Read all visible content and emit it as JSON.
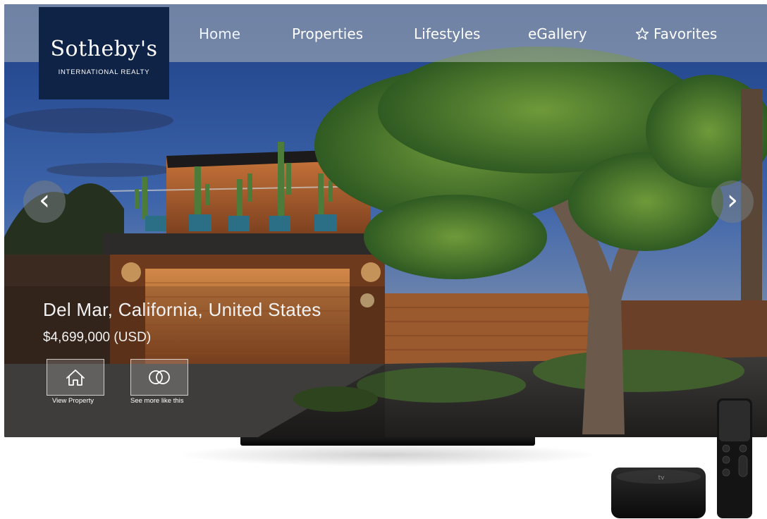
{
  "brand": {
    "name": "Sotheby's",
    "subtitle": "INTERNATIONAL REALTY",
    "color": "#0f2347"
  },
  "nav": {
    "items": [
      {
        "label": "Home",
        "active": true
      },
      {
        "label": "Properties"
      },
      {
        "label": "Lifestyles"
      },
      {
        "label": "eGallery"
      },
      {
        "label": "Favorites",
        "icon": "star-icon"
      }
    ]
  },
  "carousel": {
    "prev_icon": "‹",
    "next_icon": "›"
  },
  "listing": {
    "location": "Del Mar, California, United States",
    "price": "$4,699,000 (USD)"
  },
  "actions": [
    {
      "label": "View Property",
      "icon": "home-icon"
    },
    {
      "label": "See more like this",
      "icon": "overlapping-circles-icon"
    }
  ],
  "device": {
    "box_logo": "tv"
  }
}
